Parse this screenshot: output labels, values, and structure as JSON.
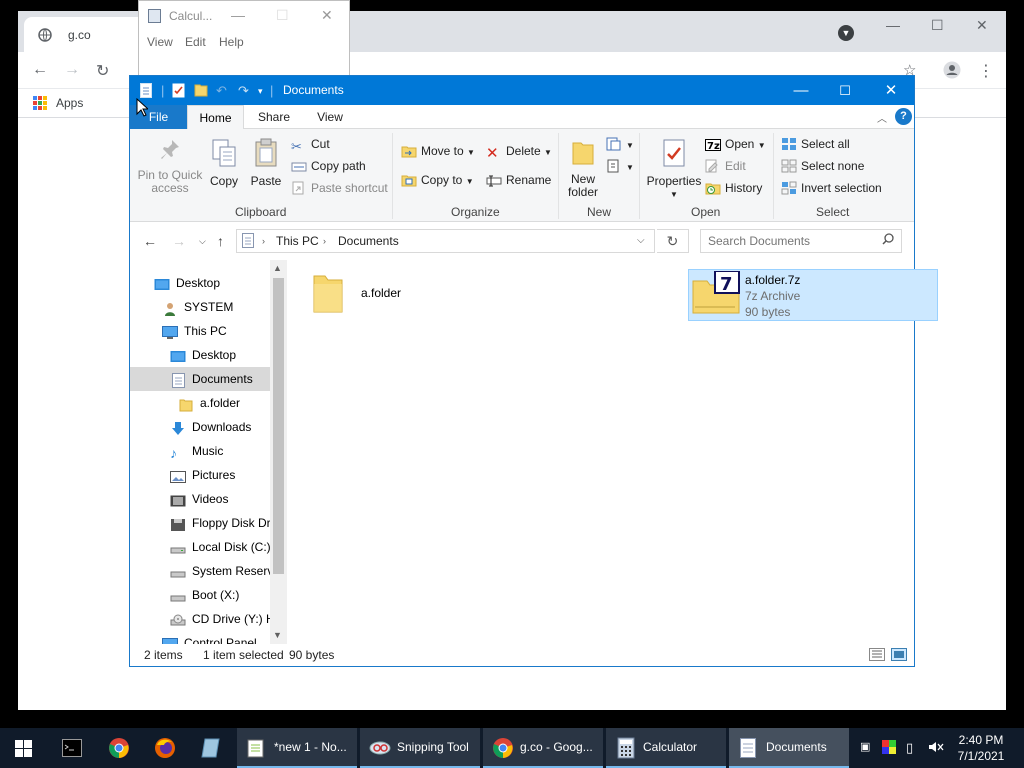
{
  "chrome": {
    "tab_title": "g.co",
    "apps_label": "Apps"
  },
  "calculator": {
    "title": "Calcul...",
    "menu": [
      "View",
      "Edit",
      "Help"
    ]
  },
  "explorer": {
    "title": "Documents",
    "ribbon_tabs": [
      "File",
      "Home",
      "Share",
      "View"
    ],
    "clipboard": {
      "pin_label": "Pin to Quick access",
      "copy_label": "Copy",
      "paste_label": "Paste",
      "cut_label": "Cut",
      "copy_path_label": "Copy path",
      "paste_shortcut_label": "Paste shortcut",
      "group_label": "Clipboard"
    },
    "organize": {
      "move_to_label": "Move to",
      "copy_to_label": "Copy to",
      "delete_label": "Delete",
      "rename_label": "Rename",
      "group_label": "Organize"
    },
    "new_group": {
      "new_folder_label": "New folder",
      "group_label": "New"
    },
    "open_group": {
      "properties_label": "Properties",
      "open_label": "Open",
      "edit_label": "Edit",
      "history_label": "History",
      "group_label": "Open"
    },
    "select_group": {
      "select_all_label": "Select all",
      "select_none_label": "Select none",
      "invert_label": "Invert selection",
      "group_label": "Select"
    },
    "address": {
      "crumbs": [
        "This PC",
        "Documents"
      ],
      "search_placeholder": "Search Documents"
    },
    "nav_items": [
      {
        "label": "Desktop"
      },
      {
        "label": "SYSTEM"
      },
      {
        "label": "This PC"
      },
      {
        "label": "Desktop"
      },
      {
        "label": "Documents"
      },
      {
        "label": "a.folder"
      },
      {
        "label": "Downloads"
      },
      {
        "label": "Music"
      },
      {
        "label": "Pictures"
      },
      {
        "label": "Videos"
      },
      {
        "label": "Floppy Disk Dri"
      },
      {
        "label": "Local Disk (C:)"
      },
      {
        "label": "System Reserve"
      },
      {
        "label": "Boot (X:)"
      },
      {
        "label": "CD Drive (Y:) H"
      },
      {
        "label": "Control Panel"
      }
    ],
    "files": [
      {
        "name": "a.folder"
      },
      {
        "name": "a.folder.7z",
        "type": "7z Archive",
        "size": "90 bytes"
      }
    ],
    "status": {
      "items": "2 items",
      "selected": "1 item selected",
      "size": "90 bytes"
    }
  },
  "taskbar": {
    "tasks": [
      "*new 1 - No...",
      "Snipping Tool",
      "g.co - Goog...",
      "Calculator",
      "Documents"
    ],
    "time": "2:40 PM",
    "date": "7/1/2021"
  },
  "colors": {
    "explorer_titlebar": "#0078d7",
    "selection": "#cce8ff",
    "taskbar": "#101b2a"
  }
}
